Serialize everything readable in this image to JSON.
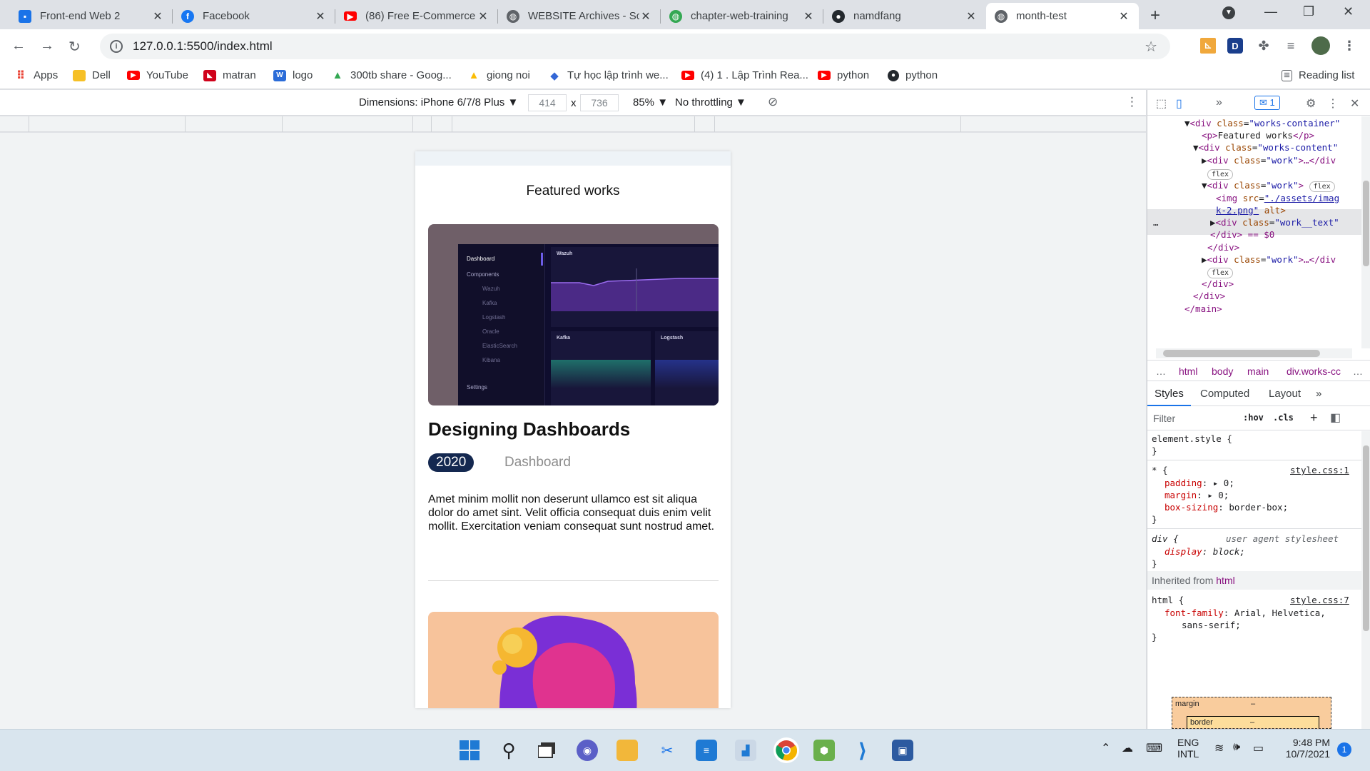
{
  "tabs": [
    {
      "title": "Front-end Web 2",
      "icon": "contact-icon",
      "color": "#1a73e8"
    },
    {
      "title": "Facebook",
      "icon": "facebook-icon",
      "color": "#1877f2"
    },
    {
      "title": "(86) Free E-Commerce",
      "icon": "youtube-icon",
      "color": "#ff0000"
    },
    {
      "title": "WEBSITE Archives - Sc",
      "icon": "globe-icon",
      "color": "#5f6368"
    },
    {
      "title": "chapter-web-training",
      "icon": "globe-icon",
      "color": "#34a853"
    },
    {
      "title": "namdfang",
      "icon": "github-icon",
      "color": "#24292e"
    },
    {
      "title": "month-test",
      "icon": "globe-icon",
      "color": "#5f6368"
    }
  ],
  "address": {
    "url": "127.0.0.1:5500/index.html"
  },
  "bookmarks": [
    {
      "label": "Apps",
      "icon": "apps-grid-icon",
      "color": "#ea4335"
    },
    {
      "label": "Dell",
      "icon": "folder-icon",
      "color": "#f6c026"
    },
    {
      "label": "YouTube",
      "icon": "youtube-icon",
      "color": "#ff0000"
    },
    {
      "label": "matran",
      "icon": "matran-icon",
      "color": "#d0021b"
    },
    {
      "label": "logo",
      "icon": "word-icon",
      "color": "#2b6cd8"
    },
    {
      "label": "300tb share - Goog...",
      "icon": "drive-icon",
      "color": "#34a853"
    },
    {
      "label": "giong noi",
      "icon": "drive-icon",
      "color": "#fbbc04"
    },
    {
      "label": "Tự học lập trình we...",
      "icon": "code-icon",
      "color": "#3367d6"
    },
    {
      "label": "(4) 1 . Lập Trình Rea...",
      "icon": "youtube-icon",
      "color": "#ff0000"
    },
    {
      "label": "python",
      "icon": "youtube-icon",
      "color": "#ff0000"
    },
    {
      "label": "python",
      "icon": "github-icon",
      "color": "#24292e"
    }
  ],
  "reading_list": "Reading list",
  "device_toolbar": {
    "dimensions": "Dimensions: iPhone 6/7/8 Plus ▼",
    "width": "414",
    "x": "x",
    "height": "736",
    "zoom": "85% ▼",
    "throttling": "No throttling ▼"
  },
  "page": {
    "section_title": "Featured works",
    "work1": {
      "title": "Designing Dashboards",
      "year": "2020",
      "category": "Dashboard",
      "description": "Amet minim mollit non deserunt ullamco est sit aliqua dolor do amet sint. Velit officia consequat duis enim velit mollit. Exercitation veniam consequat sunt nostrud amet.",
      "image": {
        "sidebar": [
          "Dashboard",
          "Components",
          "Wazuh",
          "Kafka",
          "Logstash",
          "Oracle",
          "ElasticSearch",
          "Kibana",
          "Settings"
        ],
        "panels": [
          "Wazuh",
          "Kafka",
          "Logstash"
        ]
      }
    }
  },
  "devtools": {
    "badge": "1",
    "dom": [
      {
        "tag": "div",
        "attr": "class",
        "val": "\"works-container\""
      },
      {
        "pre": "<p>",
        "text": "Featured works",
        "post": "</p>"
      },
      {
        "tag": "div",
        "attr": "class",
        "val": "\"works-content\""
      },
      {
        "tag": "div",
        "attr": "class",
        "val": "\"work\"",
        "tail": ">…</div"
      },
      {
        "pill": "flex"
      },
      {
        "tag": "div",
        "attr": "class",
        "val": "\"work\"",
        "pill": "flex"
      },
      {
        "tag": "img",
        "attr": "src",
        "val": "\"./assets/imag"
      },
      {
        "val2": "k-2.png\"",
        "attr2": " alt>"
      },
      {
        "tag": "div",
        "attr": "class",
        "val": "\"work__text\""
      },
      {
        "text": "</div> == $0"
      },
      {
        "text": "</div>"
      },
      {
        "tag": "div",
        "attr": "class",
        "val": "\"work\"",
        "tail": ">…</div"
      },
      {
        "pill": "flex"
      },
      {
        "text": "</div>"
      },
      {
        "text": "</div>"
      },
      {
        "text": "</main>"
      }
    ],
    "ellipsis": "…",
    "breadcrumbs": [
      "html",
      "body",
      "main",
      "div.works-cc"
    ],
    "style_tabs": [
      "Styles",
      "Computed",
      "Layout"
    ],
    "filter": {
      "placeholder": "Filter",
      "hov": ":hov",
      "cls": ".cls",
      "plus": "+"
    },
    "rules": {
      "element_style": "element.style {",
      "close": "}",
      "star_selector": "* {",
      "star_source": "style.css:1",
      "star_props": [
        {
          "name": "padding",
          "value": "▸ 0;"
        },
        {
          "name": "margin",
          "value": "▸ 0;"
        },
        {
          "name": "box-sizing",
          "value": "border-box;"
        }
      ],
      "div_selector": "div {",
      "div_source": "user agent stylesheet",
      "div_prop": {
        "name": "display",
        "value": "block;"
      },
      "inherited_label": "Inherited from",
      "inherited_tag": "html",
      "html_selector": "html {",
      "html_source": "style.css:7",
      "html_prop": {
        "name": "font-family",
        "value": "Arial, Helvetica,"
      },
      "html_prop_cont": "sans-serif;"
    },
    "box_model": {
      "margin": "margin",
      "margin_val": "–",
      "border": "border",
      "border_val": "–"
    }
  },
  "taskbar": {
    "lang1": "ENG",
    "lang2": "INTL",
    "time": "9:48 PM",
    "date": "10/7/2021",
    "notifications": "1"
  }
}
